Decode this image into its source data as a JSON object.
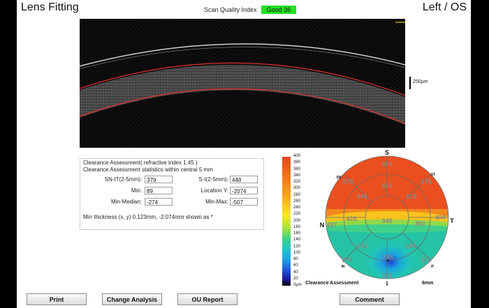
{
  "header": {
    "app_title": "Lens Fitting",
    "eye": "Left / OS"
  },
  "scan_quality": {
    "label": "Scan Quality Index",
    "status": "Good",
    "value": "36",
    "color": "#22e022"
  },
  "bscan": {
    "scale_label": "250µm"
  },
  "clearance": {
    "title": "Clearance Assessment( refractive index 1.45 )",
    "subtitle": "Clearance Assessment statistics within central 5 mm",
    "fields": {
      "sn_it": {
        "label": "SN-IT(2-5mm):",
        "value": "379"
      },
      "s_i": {
        "label": "S-I(2-5mm):",
        "value": "448"
      },
      "min": {
        "label": "Min:",
        "value": "89"
      },
      "location_y": {
        "label": "Location Y:",
        "value": "-2074"
      },
      "min_median": {
        "label": "Min-Median:",
        "value": "-274"
      },
      "min_max": {
        "label": "Min-Max:",
        "value": "-507"
      }
    },
    "min_thickness": "Min thickness (x, y) 0.123mm, -2.074mm shown as *"
  },
  "colorbar": {
    "ticks": [
      "400",
      "380",
      "360",
      "340",
      "320",
      "300",
      "280",
      "260",
      "240",
      "220",
      "200",
      "180",
      "160",
      "140",
      "120",
      "100",
      "80",
      "60",
      "40",
      "20",
      "0µm"
    ]
  },
  "map": {
    "dir_s": "S",
    "dir_i": "I",
    "dir_n": "N",
    "dir_t": "T",
    "sec_sn": "SN",
    "sec_st": "ST",
    "sec_in": "IN",
    "sec_it": "IT",
    "footer_label": "Clearance Assessment",
    "footer_size": "6mm",
    "values": {
      "s_outer": "579",
      "sn_outer": "579",
      "st_outer": "575",
      "s_mid": "570",
      "sn_mid": "548",
      "st_mid": "519",
      "n_outer": "487",
      "t_outer": "404",
      "n_mid": "428",
      "center": "340",
      "t_mid": "360",
      "in_mid": "241",
      "it_mid": "169",
      "in_outer": "278",
      "it_outer": "172",
      "i_mid": "188",
      "i_outer": "141"
    }
  },
  "buttons": {
    "print": "Print",
    "change_analysis": "Change Analysis",
    "ou_report": "OU Report",
    "comment": "Comment"
  }
}
